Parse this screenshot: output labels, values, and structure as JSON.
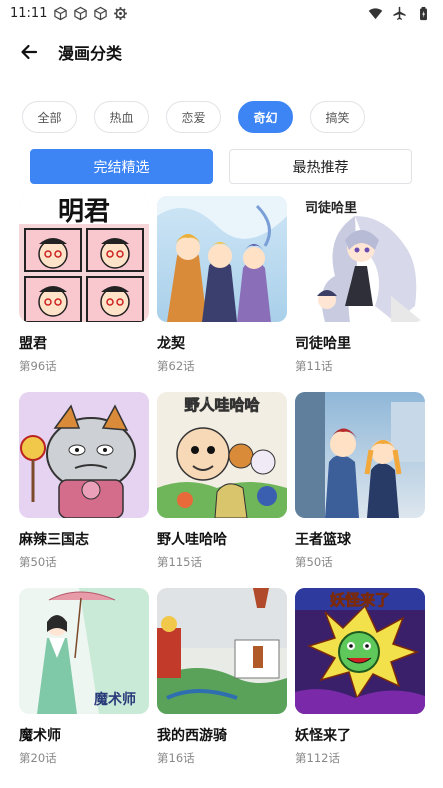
{
  "status_bar": {
    "time": "11:11",
    "left_icons": [
      "cube-icon",
      "cube-icon",
      "cube-icon",
      "gear-icon"
    ],
    "right_icons": [
      "wifi-icon",
      "airplane-icon",
      "battery-icon"
    ]
  },
  "header": {
    "back_icon": "arrow-left-icon",
    "title": "漫画分类"
  },
  "genres": [
    {
      "label": "全部",
      "active": false
    },
    {
      "label": "热血",
      "active": false
    },
    {
      "label": "恋爱",
      "active": false
    },
    {
      "label": "奇幻",
      "active": true
    },
    {
      "label": "搞笑",
      "active": false
    }
  ],
  "tabs": [
    {
      "label": "完结精选",
      "active": true
    },
    {
      "label": "最热推荐",
      "active": false
    }
  ],
  "comics": [
    {
      "title": "盟君",
      "chapter": "第96话",
      "cover_text": "明君"
    },
    {
      "title": "龙契",
      "chapter": "第62话",
      "cover_text": ""
    },
    {
      "title": "司徒哈里",
      "chapter": "第11话",
      "cover_text": "司徒哈里"
    },
    {
      "title": "麻辣三国志",
      "chapter": "第50话",
      "cover_text": ""
    },
    {
      "title": "野人哇哈哈",
      "chapter": "第115话",
      "cover_text": "野人哇哈哈"
    },
    {
      "title": "王者篮球",
      "chapter": "第50话",
      "cover_text": ""
    },
    {
      "title": "魔术师",
      "chapter": "第20话",
      "cover_text": "魔术师"
    },
    {
      "title": "我的西游骑",
      "chapter": "第16话",
      "cover_text": ""
    },
    {
      "title": "妖怪来了",
      "chapter": "第112话",
      "cover_text": "妖怪来了"
    }
  ],
  "colors": {
    "accent": "#3d84f5",
    "chip_border": "#e3e3e8",
    "subtitle": "#888888"
  }
}
